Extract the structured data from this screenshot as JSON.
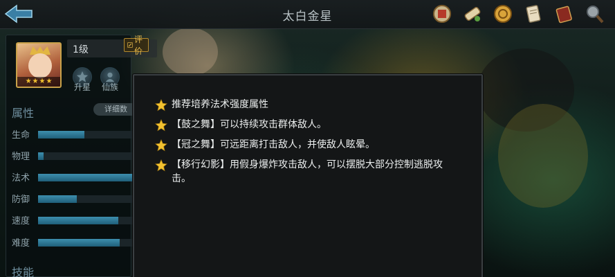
{
  "header": {
    "title": "太白金星",
    "icons": [
      "back-arrow-icon",
      "seal-icon",
      "scroll-icon",
      "coin-icon",
      "parchment-icon",
      "book-icon",
      "magnifier-icon"
    ]
  },
  "hero": {
    "level": "1级",
    "rate_label": "评价",
    "stars": [
      "★",
      "★",
      "★",
      "★"
    ],
    "buttons": [
      {
        "label": "升星",
        "icon": "star-up-icon"
      },
      {
        "label": "仙族",
        "icon": "clan-icon"
      }
    ]
  },
  "attributes": {
    "title": "属性",
    "detail_label": "详细数",
    "rows": [
      {
        "label": "生命",
        "level": 0.49
      },
      {
        "label": "物理",
        "level": 0.06
      },
      {
        "label": "法术",
        "level": 1.0
      },
      {
        "label": "防御",
        "level": 0.41
      },
      {
        "label": "速度",
        "level": 0.85
      },
      {
        "label": "难度",
        "level": 0.87
      }
    ]
  },
  "skills": {
    "title": "技能"
  },
  "tips": [
    {
      "text": "推荐培养法术强度属性"
    },
    {
      "text": "【鼓之舞】可以持续攻击群体敌人。"
    },
    {
      "text": "【冠之舞】可远距离打击敌人，并使敌人眩晕。"
    },
    {
      "text": "【移行幻影】用假身爆炸攻击敌人，可以摆脱大部分控制逃脱攻击。"
    }
  ],
  "colors": {
    "accent_gold": "#f3c230",
    "bar_fill": "#2f7d9c",
    "section_title": "#6f8f9f"
  }
}
